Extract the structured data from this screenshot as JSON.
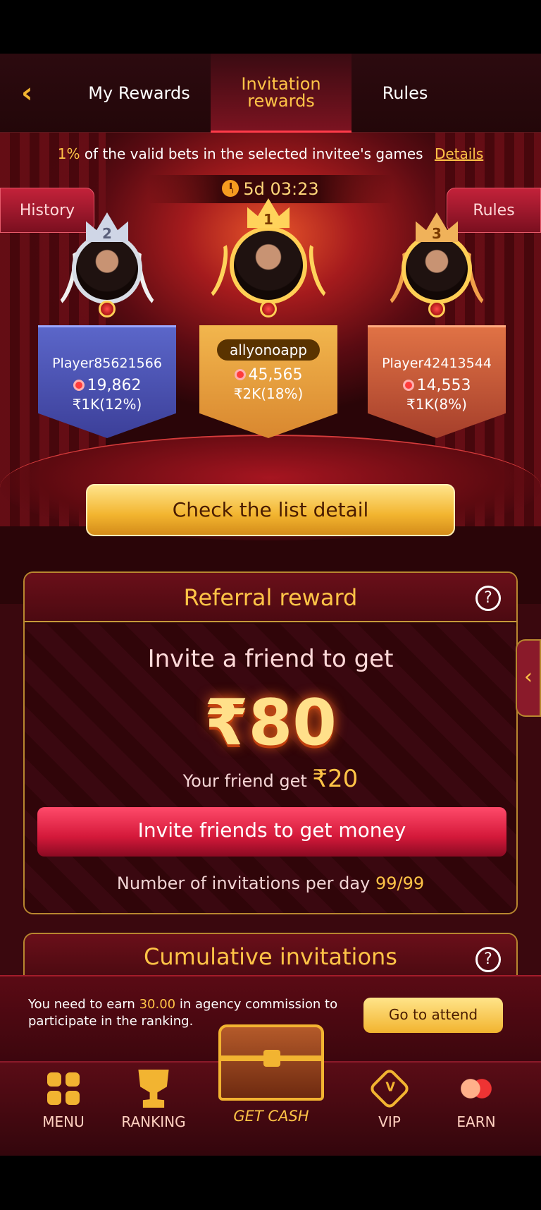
{
  "header": {
    "back_icon": "chevron-left-icon",
    "tabs": [
      {
        "label": "My Rewards",
        "active": false
      },
      {
        "label": "Invitation rewards",
        "active": true
      },
      {
        "label": "Rules",
        "active": false
      }
    ]
  },
  "notice": {
    "percent": "1%",
    "text": "of the valid bets in the selected invitee's games",
    "details_link": "Details"
  },
  "timer": {
    "value": "5d 03:23"
  },
  "side_buttons": {
    "history": "History",
    "rules": "Rules"
  },
  "podium": [
    {
      "rank": "2",
      "name": "Player85621566",
      "score": "19,862",
      "reward": "₹1K(12%)"
    },
    {
      "rank": "1",
      "name": "allyonoapp",
      "score": "45,565",
      "reward": "₹2K(18%)"
    },
    {
      "rank": "3",
      "name": "Player42413544",
      "score": "14,553",
      "reward": "₹1K(8%)"
    }
  ],
  "check_list_button": "Check the list detail",
  "referral": {
    "title": "Referral reward",
    "help": "?",
    "invite_text": "Invite a friend to get",
    "amount": "₹80",
    "friend_text": "Your friend get",
    "friend_amount": "₹20",
    "invite_button": "Invite friends to get money",
    "per_day_label": "Number of invitations per day",
    "per_day_count": "99/99"
  },
  "cumulative": {
    "title": "Cumulative invitations",
    "help": "?"
  },
  "side_tab": "‹",
  "agency": {
    "text_before": "You need to earn",
    "amount": "30.00",
    "text_after": "in agency commission to participate in the ranking.",
    "button": "Go to attend"
  },
  "nav": {
    "menu": "MENU",
    "ranking": "RANKING",
    "get_cash": "GET CASH",
    "vip": "VIP",
    "vip_glyph": "V",
    "earn": "EARN"
  },
  "colors": {
    "accent_gold": "#ffc447",
    "brand_red": "#d4193a",
    "background": "#3a080e"
  }
}
